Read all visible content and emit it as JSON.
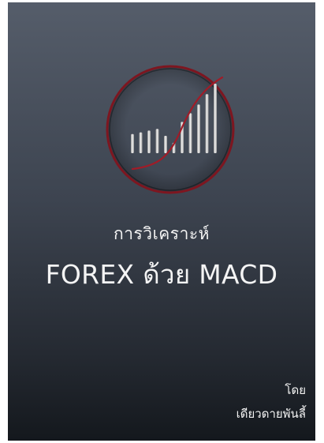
{
  "cover": {
    "subtitle": "การวิเคราะห์",
    "title": "FOREX ด้วย MACD",
    "by_label": "โดย",
    "author": "เดียวดายพันลี้"
  },
  "logo": {
    "icon": "rising-bars-chart-icon",
    "ring_color": "#8a1a24",
    "curve_color": "#a01c28",
    "bar_color": "#d8d8d8",
    "bar_levels": [
      0.22,
      0.24,
      0.26,
      0.28,
      0.2,
      0.12,
      0.36,
      0.46,
      0.56,
      0.68,
      0.8
    ]
  },
  "colors": {
    "background_top": "#555d6a",
    "background_bottom": "#14181d",
    "text": "#f2f2f2"
  }
}
